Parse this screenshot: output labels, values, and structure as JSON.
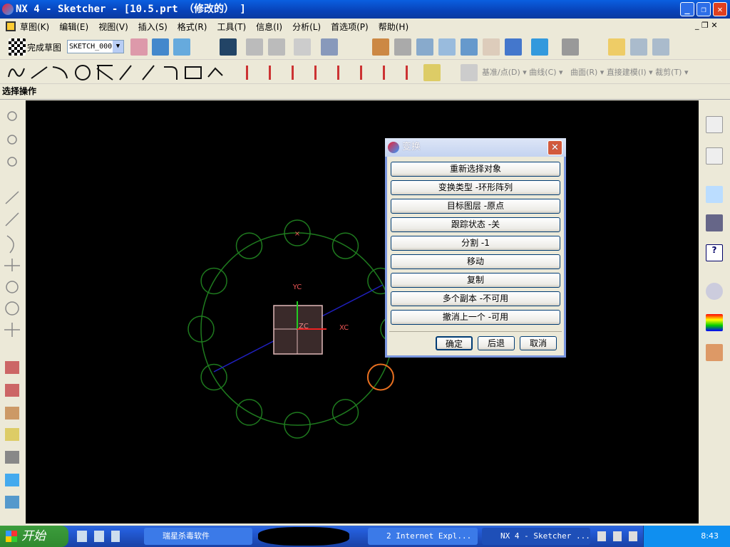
{
  "window": {
    "title": "NX 4 - Sketcher - [10.5.prt （修改的） ]"
  },
  "menu": [
    "草图(K)",
    "编辑(E)",
    "视图(V)",
    "插入(S)",
    "格式(R)",
    "工具(T)",
    "信息(I)",
    "分析(L)",
    "首选项(P)",
    "帮助(H)"
  ],
  "toolbar1": {
    "finish_sketch": "完成草图",
    "sketch_select": "SKETCH_000"
  },
  "toolbar2": {
    "menus": [
      "基准/点(D)",
      "曲线(C)",
      "曲面(R)",
      "直接建模(I)",
      "裁剪(T)"
    ]
  },
  "status": "选择操作",
  "canvas": {
    "labels": {
      "yc": "YC",
      "xc": "XC",
      "zc": "ZC"
    },
    "colors": {
      "curves": "#1e7a1e",
      "selected": "#e87020",
      "axis_line": "#2020c0",
      "background": "#000000"
    },
    "pattern_count": 12
  },
  "dialog": {
    "title": "变换",
    "buttons": [
      "重新选择对象",
      "变换类型 -环形阵列",
      "目标图层 -原点",
      "跟踪状态 -关",
      "分割 -1",
      "移动",
      "复制",
      "多个副本 -不可用",
      "撤消上一个 -可用"
    ],
    "ok": "确定",
    "back": "后退",
    "cancel": "取消"
  },
  "taskbar": {
    "start": "开始",
    "tasks": [
      "瑞星杀毒软件",
      "2 Internet Expl...",
      "NX 4 - Sketcher ..."
    ],
    "clock": "8:43"
  }
}
